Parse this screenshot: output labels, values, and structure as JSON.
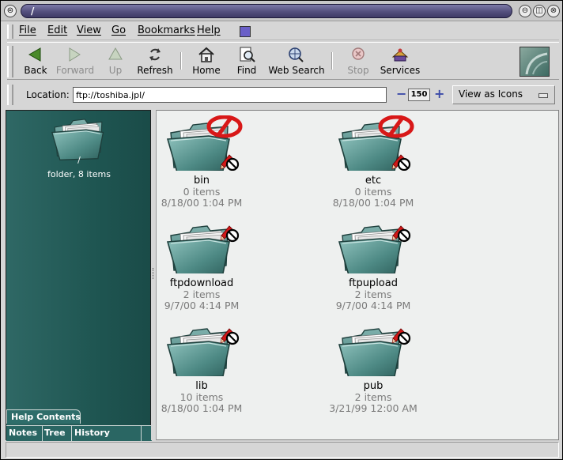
{
  "window": {
    "title": "/"
  },
  "menubar": {
    "items": [
      "File",
      "Edit",
      "View",
      "Go",
      "Bookmarks",
      "Help"
    ]
  },
  "toolbar": {
    "back": "Back",
    "forward": "Forward",
    "up": "Up",
    "refresh": "Refresh",
    "home": "Home",
    "find": "Find",
    "web_search": "Web Search",
    "stop": "Stop",
    "services": "Services"
  },
  "location": {
    "label": "Location:",
    "value": "ftp://toshiba.jpl/",
    "zoom": "150",
    "view_mode": "View as Icons"
  },
  "sidebar": {
    "name": "/",
    "info": "folder, 8 items",
    "tabs": {
      "help": "Help Contents",
      "notes": "Notes",
      "tree": "Tree",
      "history": "History"
    }
  },
  "files": [
    {
      "name": "bin",
      "items": "0 items",
      "date": "8/18/00 1:04 PM",
      "no_read": true
    },
    {
      "name": "etc",
      "items": "0 items",
      "date": "8/18/00 1:04 PM",
      "no_read": true
    },
    {
      "name": "ftpdownload",
      "items": "2 items",
      "date": "9/7/00 4:14 PM",
      "no_read": false
    },
    {
      "name": "ftpupload",
      "items": "2 items",
      "date": "9/7/00 4:14 PM",
      "no_read": false
    },
    {
      "name": "lib",
      "items": "10 items",
      "date": "8/18/00 1:04 PM",
      "no_read": false
    },
    {
      "name": "pub",
      "items": "2 items",
      "date": "3/21/99 12:00 AM",
      "no_read": false
    }
  ]
}
